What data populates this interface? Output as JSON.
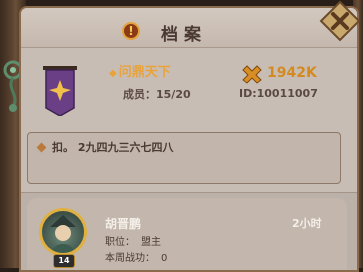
{
  "header": {
    "title": "档案",
    "title_icon": "exclamation-icon"
  },
  "guild": {
    "name": "问鼎天下",
    "members_label": "成员：",
    "members_value": "15/20",
    "power": "1942K",
    "id_text": "ID:10011007",
    "banner_color": "#6b3f86"
  },
  "notice": {
    "text": "扣。 2九四九三六七四八"
  },
  "member": {
    "name": "胡晋鹏",
    "online": "2小时",
    "role_label": "职位：",
    "role_value": "盟主",
    "weekly_power_label": "本周战功：",
    "weekly_power_value": "0",
    "level": "14"
  },
  "colors": {
    "accent_gold": "#e9a33a",
    "panel": "#c8bdb4"
  }
}
